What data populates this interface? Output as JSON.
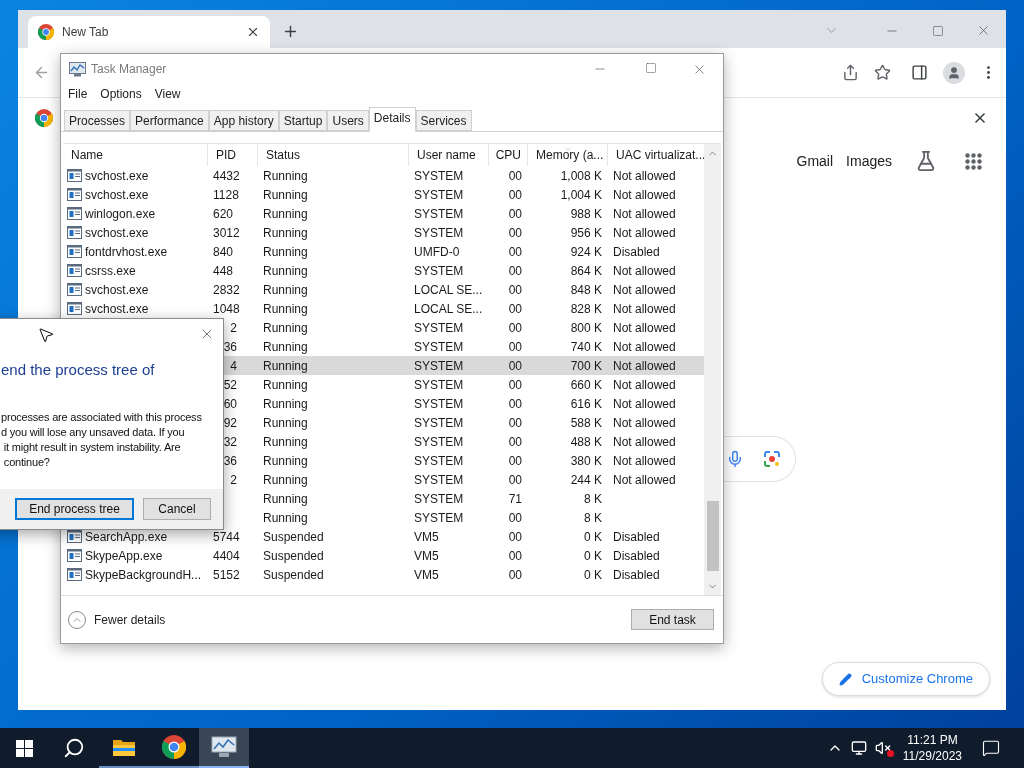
{
  "browser": {
    "tab_title": "New Tab",
    "links": [
      "Gmail",
      "Images"
    ],
    "customize_button": "Customize Chrome"
  },
  "task_manager": {
    "title": "Task Manager",
    "menu": [
      "File",
      "Options",
      "View"
    ],
    "tabs": [
      {
        "label": "Processes",
        "selected": false
      },
      {
        "label": "Performance",
        "selected": false
      },
      {
        "label": "App history",
        "selected": false
      },
      {
        "label": "Startup",
        "selected": false
      },
      {
        "label": "Users",
        "selected": false
      },
      {
        "label": "Details",
        "selected": true
      },
      {
        "label": "Services",
        "selected": false
      }
    ],
    "columns": [
      {
        "label": "Name",
        "sorted": false
      },
      {
        "label": "PID",
        "sorted": false
      },
      {
        "label": "Status",
        "sorted": false
      },
      {
        "label": "User name",
        "sorted": false
      },
      {
        "label": "CPU",
        "sorted": false
      },
      {
        "label": "Memory (a...",
        "sorted": true
      },
      {
        "label": "UAC virtualizat...",
        "sorted": false
      }
    ],
    "rows": [
      {
        "name": "svchost.exe",
        "pid": "4432",
        "status": "Running",
        "user": "SYSTEM",
        "cpu": "00",
        "memory": "1,008 K",
        "uac": "Not allowed",
        "selected": false,
        "covered": false
      },
      {
        "name": "svchost.exe",
        "pid": "1128",
        "status": "Running",
        "user": "SYSTEM",
        "cpu": "00",
        "memory": "1,004 K",
        "uac": "Not allowed",
        "selected": false,
        "covered": false
      },
      {
        "name": "winlogon.exe",
        "pid": "620",
        "status": "Running",
        "user": "SYSTEM",
        "cpu": "00",
        "memory": "988 K",
        "uac": "Not allowed",
        "selected": false,
        "covered": false
      },
      {
        "name": "svchost.exe",
        "pid": "3012",
        "status": "Running",
        "user": "SYSTEM",
        "cpu": "00",
        "memory": "956 K",
        "uac": "Not allowed",
        "selected": false,
        "covered": false
      },
      {
        "name": "fontdrvhost.exe",
        "pid": "840",
        "status": "Running",
        "user": "UMFD-0",
        "cpu": "00",
        "memory": "924 K",
        "uac": "Disabled",
        "selected": false,
        "covered": false
      },
      {
        "name": "csrss.exe",
        "pid": "448",
        "status": "Running",
        "user": "SYSTEM",
        "cpu": "00",
        "memory": "864 K",
        "uac": "Not allowed",
        "selected": false,
        "covered": false
      },
      {
        "name": "svchost.exe",
        "pid": "2832",
        "status": "Running",
        "user": "LOCAL SE...",
        "cpu": "00",
        "memory": "848 K",
        "uac": "Not allowed",
        "selected": false,
        "covered": false
      },
      {
        "name": "svchost.exe",
        "pid": "1048",
        "status": "Running",
        "user": "LOCAL SE...",
        "cpu": "00",
        "memory": "828 K",
        "uac": "Not allowed",
        "selected": false,
        "covered": false
      },
      {
        "pid": "2",
        "status": "Running",
        "user": "SYSTEM",
        "cpu": "00",
        "memory": "800 K",
        "uac": "Not allowed",
        "selected": false,
        "covered": true
      },
      {
        "pid": "36",
        "status": "Running",
        "user": "SYSTEM",
        "cpu": "00",
        "memory": "740 K",
        "uac": "Not allowed",
        "selected": false,
        "covered": true
      },
      {
        "pid": "4",
        "status": "Running",
        "user": "SYSTEM",
        "cpu": "00",
        "memory": "700 K",
        "uac": "Not allowed",
        "selected": true,
        "covered": true
      },
      {
        "pid": "52",
        "status": "Running",
        "user": "SYSTEM",
        "cpu": "00",
        "memory": "660 K",
        "uac": "Not allowed",
        "selected": false,
        "covered": true
      },
      {
        "pid": "60",
        "status": "Running",
        "user": "SYSTEM",
        "cpu": "00",
        "memory": "616 K",
        "uac": "Not allowed",
        "selected": false,
        "covered": true
      },
      {
        "pid": "92",
        "status": "Running",
        "user": "SYSTEM",
        "cpu": "00",
        "memory": "588 K",
        "uac": "Not allowed",
        "selected": false,
        "covered": true
      },
      {
        "pid": "32",
        "status": "Running",
        "user": "SYSTEM",
        "cpu": "00",
        "memory": "488 K",
        "uac": "Not allowed",
        "selected": false,
        "covered": true
      },
      {
        "pid": "36",
        "status": "Running",
        "user": "SYSTEM",
        "cpu": "00",
        "memory": "380 K",
        "uac": "Not allowed",
        "selected": false,
        "covered": true
      },
      {
        "pid": "2",
        "status": "Running",
        "user": "SYSTEM",
        "cpu": "00",
        "memory": "244 K",
        "uac": "Not allowed",
        "selected": false,
        "covered": true
      },
      {
        "status": "Running",
        "user": "SYSTEM",
        "cpu": "71",
        "memory": "8 K",
        "selected": false
      },
      {
        "status": "Running",
        "user": "SYSTEM",
        "cpu": "00",
        "memory": "8 K",
        "selected": false
      },
      {
        "name": "SearchApp.exe",
        "pid": "5744",
        "status": "Suspended",
        "user": "VM5",
        "cpu": "00",
        "memory": "0 K",
        "uac": "Disabled",
        "selected": false,
        "covered": false
      },
      {
        "name": "SkypeApp.exe",
        "pid": "4404",
        "status": "Suspended",
        "user": "VM5",
        "cpu": "00",
        "memory": "0 K",
        "uac": "Disabled",
        "selected": false,
        "covered": false
      },
      {
        "name": "SkypeBackgroundH...",
        "pid": "5152",
        "status": "Suspended",
        "user": "VM5",
        "cpu": "00",
        "memory": "0 K",
        "uac": "Disabled",
        "selected": false,
        "covered": false
      }
    ],
    "fewer_details": "Fewer details",
    "end_task": "End task"
  },
  "dialog": {
    "heading": "end the process tree of",
    "body_lines": [
      "processes are associated with this process",
      "d you will lose any unsaved data. If you",
      " it might result in system instability. Are",
      " continue?"
    ],
    "buttons": [
      {
        "label": "End process tree",
        "focused": true
      },
      {
        "label": "Cancel",
        "focused": false
      }
    ]
  },
  "taskbar": {
    "apps": [
      {
        "kind": "explorer",
        "active": false
      },
      {
        "kind": "chrome",
        "active": false
      },
      {
        "kind": "taskmanager",
        "active": true
      }
    ],
    "time": "11:21 PM",
    "date": "11/29/2023"
  }
}
